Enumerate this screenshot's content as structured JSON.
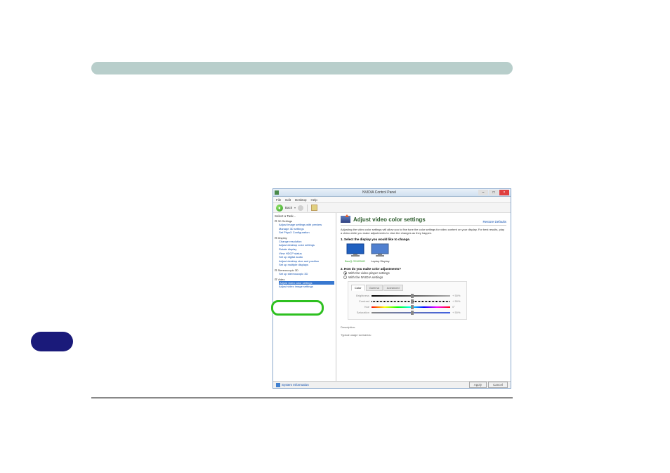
{
  "titlebar": {
    "title": "NVIDIA Control Panel"
  },
  "menu": {
    "file": "File",
    "edit": "Edit",
    "desktop": "Desktop",
    "help": "Help"
  },
  "toolbar": {
    "back": "Back"
  },
  "sidebar": {
    "title": "Select a Task...",
    "cat3d": "3D Settings",
    "s3d1": "Adjust image settings with preview",
    "s3d2": "Manage 3D settings",
    "s3d3": "Set PhysX Configuration",
    "catDisplay": "Display",
    "d1": "Change resolution",
    "d2": "Adjust desktop color settings",
    "d3": "Rotate display",
    "d4": "View HDCP status",
    "d5": "Set up digital audio",
    "d6": "Adjust desktop size and position",
    "d7": "Set up multiple displays",
    "catStereo": "Stereoscopic 3D",
    "st1": "Set up stereoscopic 3D",
    "catVideo": "Video",
    "v1": "Adjust video color settings",
    "v2": "Adjust video image settings"
  },
  "panel": {
    "title": "Adjust video color settings",
    "restore": "Restore Defaults",
    "desc": "Adjusting the video color settings will allow you to fine tune the color settings for video content on your display. For best results, play a video while you make adjustments to view the changes as they happen.",
    "step1": "1. Select the display you would like to change.",
    "display1": "BenQ G2420HD",
    "display2": "Laptop Display",
    "step2": "2. How do you make color adjustments?",
    "radio1": "With the video player settings",
    "radio2": "With the NVIDIA settings",
    "tabs": {
      "color": "Color",
      "gamma": "Gamma",
      "advanced": "Advanced"
    },
    "sliders": {
      "brightness": "Brightness",
      "brightness_val": "+ 50%",
      "contrast": "Contrast",
      "contrast_val": "+ 50%",
      "hue": "Hue",
      "hue_val": "0°",
      "saturation": "Saturation",
      "saturation_val": "+ 50%"
    },
    "descLabel": "Description:",
    "descText": "Typical usage scenarios:"
  },
  "status": {
    "sysinfo": "System Information",
    "apply": "Apply",
    "cancel": "Cancel"
  }
}
